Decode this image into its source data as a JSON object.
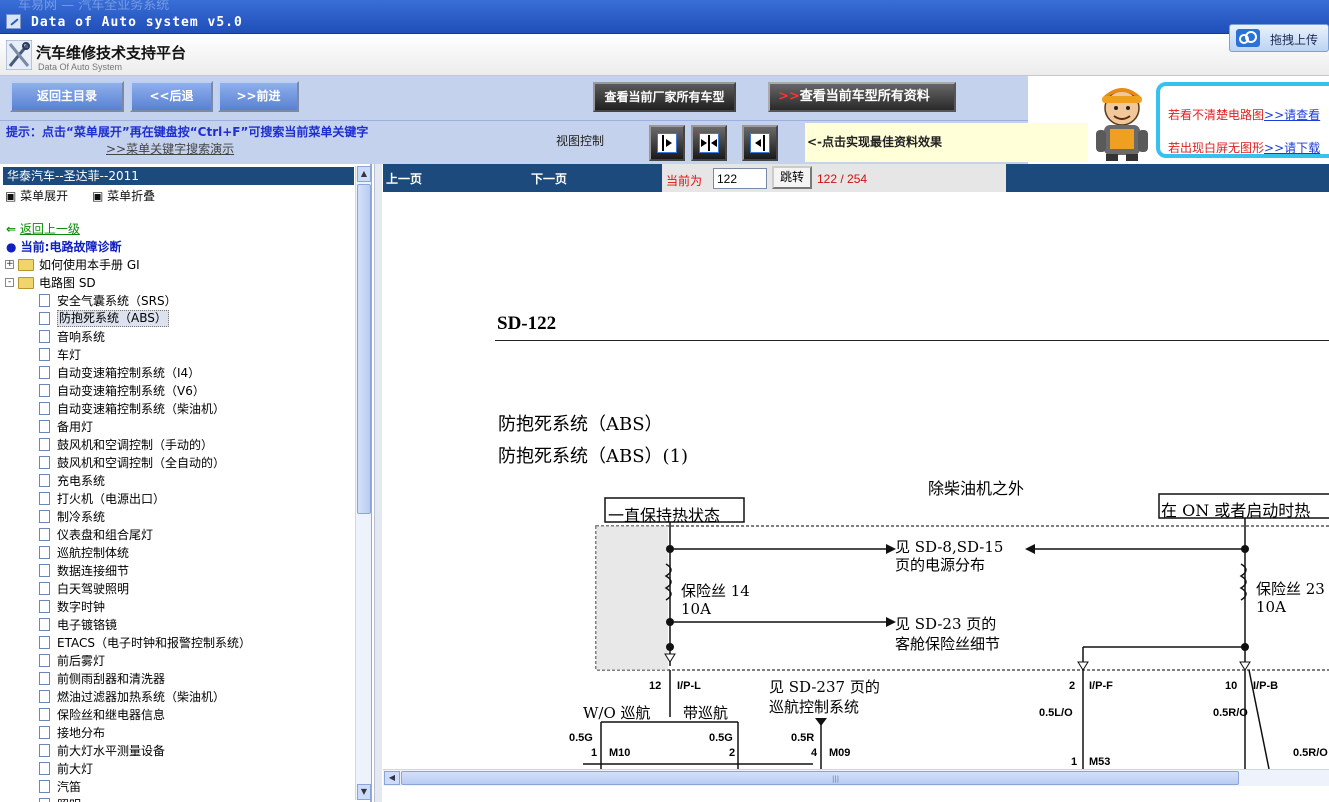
{
  "window": {
    "title": "Data of Auto system v5.0",
    "ghost_title": "车易网 — 汽车全业务系统"
  },
  "header": {
    "brand": "汽车维修技术支持平台",
    "brand_sub": "Data Of Auto System",
    "upload_label": "拖拽上传"
  },
  "toolbar": {
    "home_label": "返回主目录",
    "back_label": "<<后退",
    "forward_label": ">>前进",
    "all_models_label": "查看当前厂家所有车型",
    "all_docs_arrow": ">>",
    "all_docs_label": "查看当前车型所有资料"
  },
  "promo": {
    "line1_text": "若看不清楚电路图",
    "line1_link": ">>请查看",
    "line2_text": "若出现白屏无图形",
    "line2_link": ">>请下载"
  },
  "tipbar": {
    "tip": "提示：点击“菜单展开”再在键盘按“Ctrl+F”可搜索当前菜单关键字",
    "demo_link": ">>菜单关键字搜索演示",
    "view_control": "视图控制",
    "best_view": "<-点击实现最佳资料效果"
  },
  "sidebar": {
    "vehicle": "华泰汽车--圣达菲--2011",
    "expand_label": "菜单展开",
    "collapse_label": "菜单折叠",
    "back_up_label": "返回上一级",
    "current_label": "当前:电路故障诊断",
    "nodes": [
      {
        "label": "如何使用本手册 GI",
        "sign": "+"
      },
      {
        "label": "电路图 SD",
        "sign": "-"
      }
    ],
    "leaves": [
      "安全气囊系统（SRS）",
      "防抱死系统（ABS）",
      "音响系统",
      "车灯",
      "自动变速箱控制系统（I4）",
      "自动变速箱控制系统（V6）",
      "自动变速箱控制系统（柴油机）",
      "备用灯",
      "鼓风机和空调控制（手动的）",
      "鼓风机和空调控制（全自动的）",
      "充电系统",
      "打火机（电源出口）",
      "制冷系统",
      "仪表盘和组合尾灯",
      "巡航控制体统",
      "数据连接细节",
      "白天驾驶照明",
      "数字时钟",
      "电子镀铬镜",
      "ETACS（电子时钟和报警控制系统）",
      "前后雾灯",
      "前侧雨刮器和清洗器",
      "燃油过滤器加热系统（柴油机）",
      "保险丝和继电器信息",
      "接地分布",
      "前大灯水平测量设备",
      "前大灯",
      "汽笛",
      "照明"
    ],
    "selected_index": 1
  },
  "pagenav": {
    "prev_label": "上一页",
    "next_label": "下一页",
    "current_label": "当前为",
    "page_value": "122",
    "go_label": "跳转",
    "count": "122 / 254"
  },
  "document": {
    "code": "SD-122",
    "title1": "防抱死系统（ABS）",
    "title2": "防抱死系统（ABS）(1)",
    "except_diesel": "除柴油机之外",
    "hot_always": "一直保持热状态",
    "hot_on": "在 ON 或者启动时热",
    "power_ref_1": "见 SD-8,SD-15",
    "power_ref_2": "页的电源分布",
    "fuse14": "保险丝 14",
    "fuse14_a": "10A",
    "fuse23": "保险丝 23",
    "fuse23_a": "10A",
    "fuse_ref_1": "见 SD-23 页的",
    "fuse_ref_2": "客舱保险丝细节",
    "cruise_ref_1": "见 SD-237 页的",
    "cruise_ref_2": "巡航控制系统",
    "wo_cruise": "W/O 巡航",
    "with_cruise": "带巡航",
    "pin12": "12",
    "ipl": "I/P-L",
    "pin2": "2",
    "ipf": "I/P-F",
    "pin10": "10",
    "ipb": "I/P-B",
    "w05g_a": "0.5G",
    "w05g_b": "0.5G",
    "w05r": "0.5R",
    "w05lo": "0.5L/O",
    "w05ro": "0.5R/O",
    "w05ro2": "0.5R/O",
    "m10_pin": "1",
    "m10": "M10",
    "m10b_pin": "2",
    "m09_pin": "4",
    "m09": "M09",
    "m53_pin": "1",
    "m53": "M53"
  }
}
